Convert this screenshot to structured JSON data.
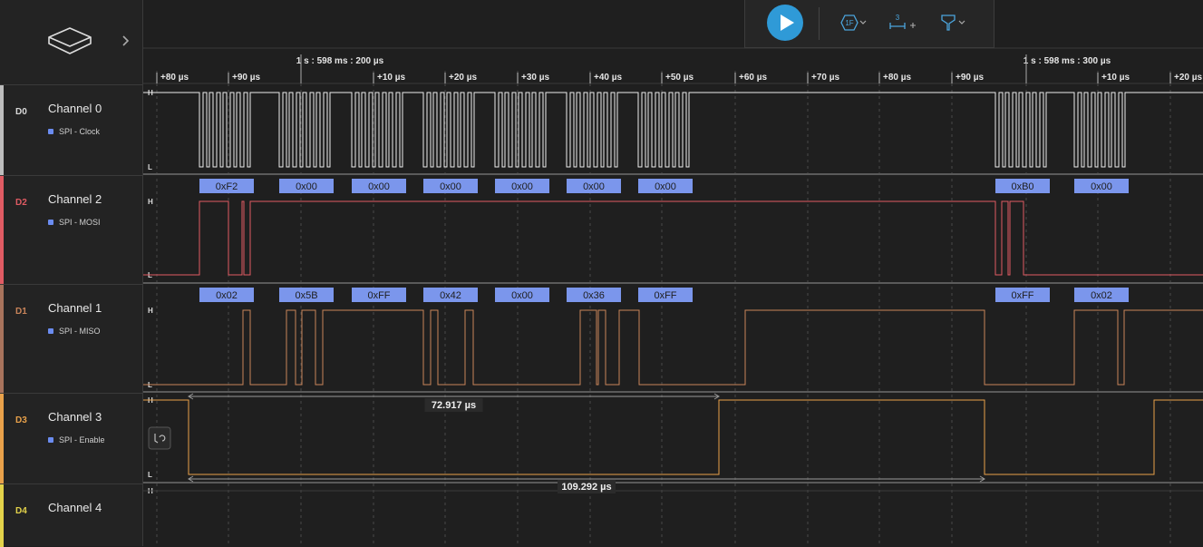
{
  "channels": [
    {
      "id": "D0",
      "name": "Channel 0",
      "analyzer": "SPI - Clock",
      "color": "#d9d9d9"
    },
    {
      "id": "D2",
      "name": "Channel 2",
      "analyzer": "SPI - MOSI",
      "color": "#e05b63"
    },
    {
      "id": "D1",
      "name": "Channel 1",
      "analyzer": "SPI - MISO",
      "color": "#c9845a"
    },
    {
      "id": "D3",
      "name": "Channel 3",
      "analyzer": "SPI - Enable",
      "color": "#e8a14a"
    },
    {
      "id": "D4",
      "name": "Channel 4",
      "analyzer": "",
      "color": "#e3d24a"
    }
  ],
  "toolbar": {
    "trigger_label": "1F",
    "measure_label": "3",
    "play_icon": "play-icon",
    "trigger_icon": "hex-trigger-icon",
    "measure_icon": "measure-icon",
    "marker_icon": "marker-pin-icon"
  },
  "timeline": {
    "anchor_labels": [
      "1 s : 598 ms : 200 µs",
      "1 s : 598 ms : 300 µs"
    ],
    "ticks": [
      "+80 µs",
      "+90 µs",
      "+10 µs",
      "+20 µs",
      "+30 µs",
      "+40 µs",
      "+50 µs",
      "+60 µs",
      "+70 µs",
      "+80 µs",
      "+90 µs",
      "+10 µs",
      "+20 µs"
    ]
  },
  "level_labels": {
    "high": "H",
    "low": "L"
  },
  "decoded": {
    "mosi": [
      "0xF2",
      "0x00",
      "0x00",
      "0x00",
      "0x00",
      "0x00",
      "0x00",
      "0xB0",
      "0x00"
    ],
    "miso": [
      "0x02",
      "0x5B",
      "0xFF",
      "0x42",
      "0x00",
      "0x36",
      "0xFF",
      "0xFF",
      "0x02"
    ]
  },
  "measurements": [
    "72.917 µs",
    "109.292 µs"
  ],
  "colors": {
    "accent": "#2f9ad7",
    "decode_box": "#7b96ec"
  }
}
